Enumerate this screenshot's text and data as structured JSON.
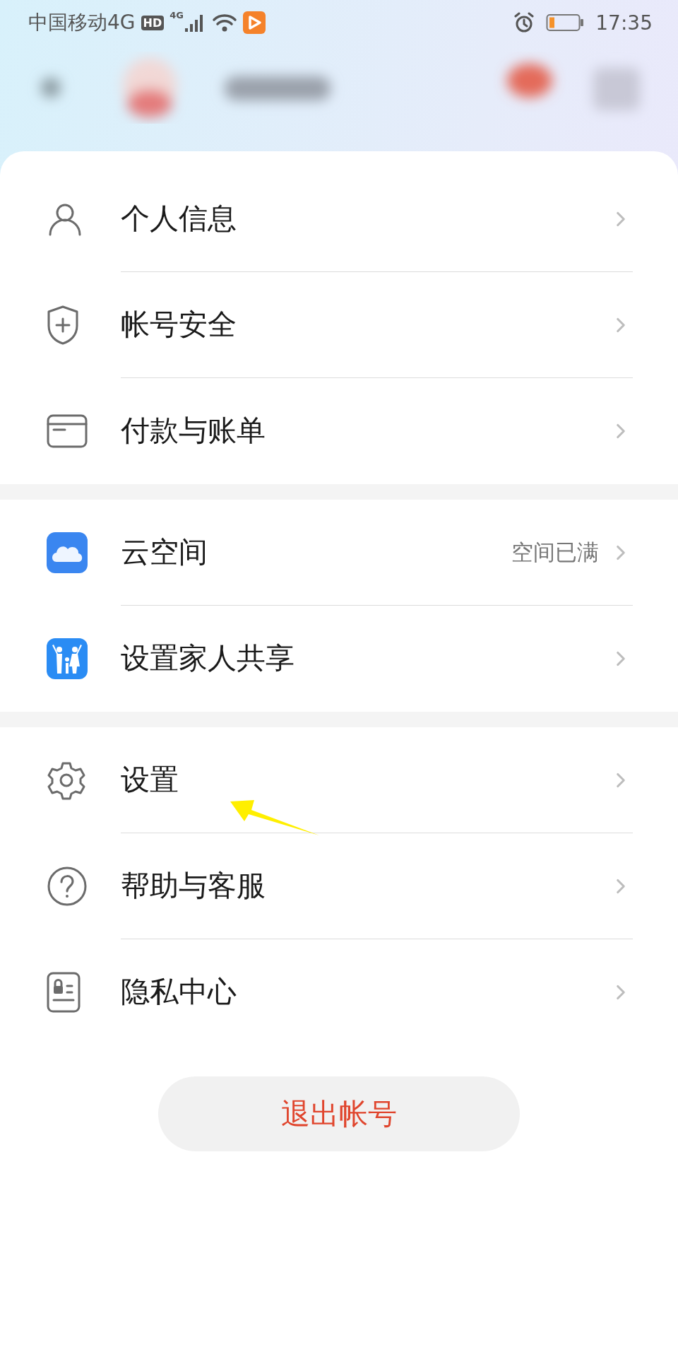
{
  "status_bar": {
    "carrier": "中国移动4G",
    "hd_badge": "HD",
    "network": "4G",
    "time": "17:35"
  },
  "groups": [
    {
      "items": [
        {
          "kind": "person",
          "label": "个人信息"
        },
        {
          "kind": "shield",
          "label": "帐号安全"
        },
        {
          "kind": "card",
          "label": "付款与账单"
        }
      ]
    },
    {
      "items": [
        {
          "kind": "cloud",
          "label": "云空间",
          "value": "空间已满"
        },
        {
          "kind": "family",
          "label": "设置家人共享"
        }
      ]
    },
    {
      "items": [
        {
          "kind": "gear",
          "label": "设置"
        },
        {
          "kind": "help",
          "label": "帮助与客服"
        },
        {
          "kind": "privacy",
          "label": "隐私中心"
        }
      ]
    }
  ],
  "logout_button": "退出帐号"
}
